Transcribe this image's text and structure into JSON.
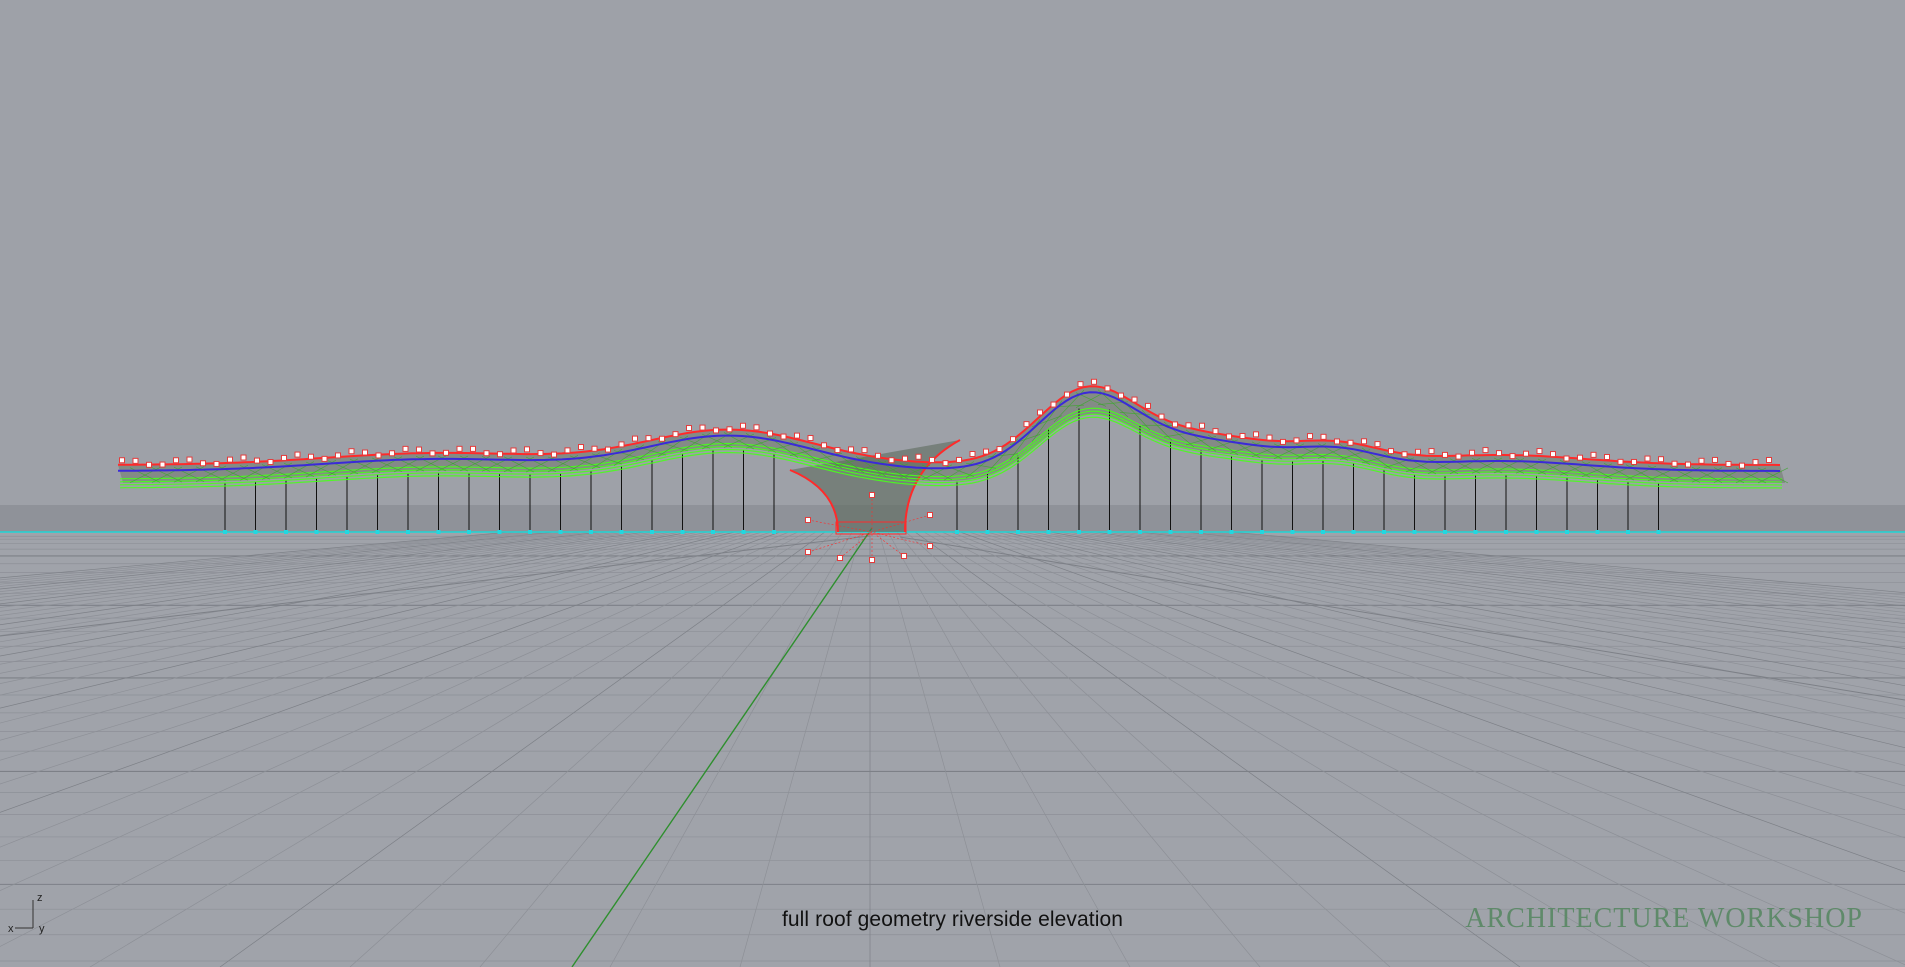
{
  "viewport": {
    "caption": "full roof geometry riverside elevation",
    "brand": "ARCHITECTURE WORKSHOP",
    "axis_widget": {
      "z_label": "z",
      "x_label": "x",
      "y_label": "y"
    }
  },
  "colors": {
    "background": "#9ea1a8",
    "ground_plane": "#a0a3aa",
    "grid_line": "#8d9097",
    "grid_major": "#7d8087",
    "horizon_line": "#1fd6d6",
    "y_axis_line": "#2e8f2e",
    "roof_top_curve": "#ff2a2a",
    "roof_blue_curve": "#3a2ad8",
    "roof_green_curve": "#48ff1a",
    "column": "#111111",
    "control_point": "#e43b3b",
    "base_point": "#22d7e0",
    "brand_text": "#5f8a6a"
  }
}
